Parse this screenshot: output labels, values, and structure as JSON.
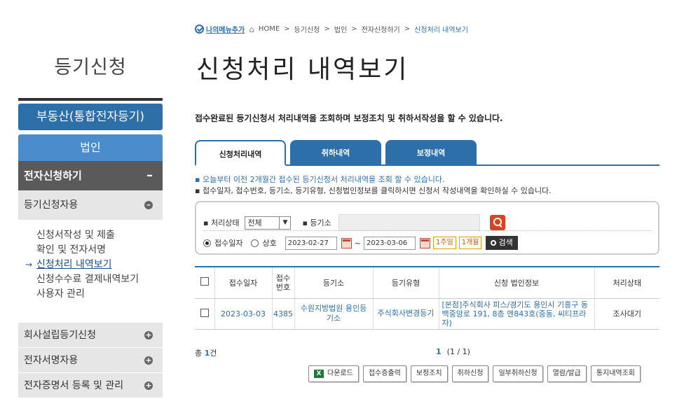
{
  "sidebar": {
    "title": "등기신청",
    "realty": "부동산(통합전자등기)",
    "corp": "법인",
    "elec_apply": "전자신청하기",
    "reg_apply": "등기신청자용",
    "sub_items": [
      "신청서작성 및 제출",
      "확인 및 전자서명",
      "신청처리 내역보기",
      "신청수수료 결제내역보기",
      "사용자 관리"
    ],
    "company_setup": "회사설립등기신청",
    "e_signer": "전자서명자용",
    "cert_mgmt": "전자증명서 등록 및 관리"
  },
  "breadcrumb": {
    "mymenu": "나의메뉴추가",
    "path": [
      "HOME",
      "등기신청",
      "법인",
      "전자신청하기"
    ],
    "current": "신청처리 내역보기"
  },
  "page_title": "신청처리 내역보기",
  "intro": "접수완료된 등기신청서 처리내역을 조회하며 보정조치 및 취하서작성을 할 수 있습니다.",
  "tabs": [
    "신청처리내역",
    "취하내역",
    "보정내역"
  ],
  "notes": [
    "오늘부터 이전 2개월간 접수된 등기신청서 처리내역을 조회 할 수 있습니다.",
    "접수일자, 접수번호, 등기소, 등기유형, 신청법인정보를 클릭하시면 신청서 작성내역을 확인하실 수 있습니다."
  ],
  "search": {
    "status_label": "처리상태",
    "status_value": "전체",
    "registry_label": "등기소",
    "radio_date": "접수일자",
    "radio_name": "상호",
    "date_from": "2023-02-27",
    "tilde": "~",
    "date_to": "2023-03-06",
    "btn_week": "1주일",
    "btn_month": "1개월",
    "btn_search": "검색"
  },
  "table": {
    "headers": [
      "접수일자",
      "접수번호",
      "등기소",
      "등기유형",
      "신청 법인정보",
      "처리상태"
    ],
    "rows": [
      {
        "date": "2023-03-03",
        "number": "4385",
        "registry": "수원지방법원 용인등기소",
        "type": "주식회사변경등기",
        "info": "[본점]주식회사 피스/경기도 용인시 기흥구 동백중앙로 191, 8층 엔843호(중동, 씨티프라자)",
        "state": "조사대기"
      }
    ]
  },
  "footer": {
    "total_prefix": "총",
    "total_count": "1",
    "total_suffix": "건",
    "page_current": "1",
    "page_info": "(1 / 1)"
  },
  "actions": [
    "다운로드",
    "접수증출력",
    "보정조치",
    "취하신청",
    "일부취하신청",
    "열람/발급",
    "통지내역조회"
  ]
}
